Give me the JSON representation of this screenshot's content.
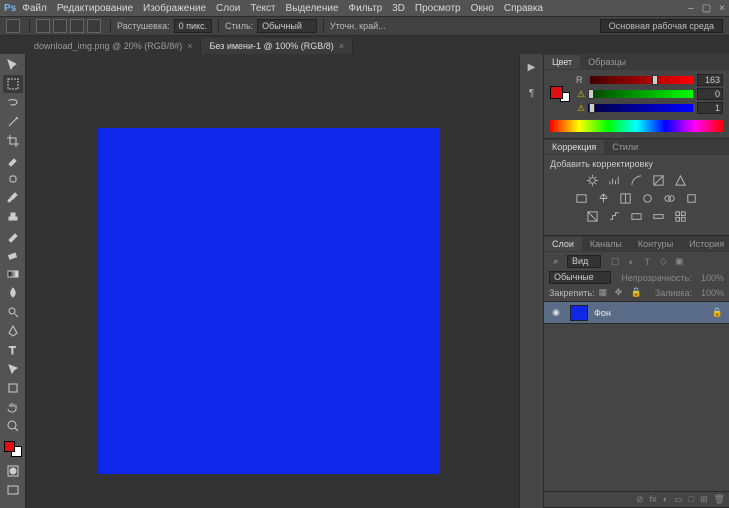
{
  "app": {
    "logo": "Ps"
  },
  "menu": {
    "items": [
      "Файл",
      "Редактирование",
      "Изображение",
      "Слои",
      "Текст",
      "Выделение",
      "Фильтр",
      "3D",
      "Просмотр",
      "Окно",
      "Справка"
    ]
  },
  "window_controls": {
    "minimize": "–",
    "restore": "▢",
    "close": "×"
  },
  "options": {
    "feather_label": "Растушевка:",
    "feather_value": "0 пикс.",
    "style_label": "Стиль:",
    "style_value": "Обычный",
    "refine_label": "Уточн. край...",
    "workspace": "Основная рабочая среда"
  },
  "tabs": [
    {
      "label": "download_img.png @ 20% (RGB/8#)",
      "close": "×"
    },
    {
      "label": "Без имени-1 @ 100% (RGB/8)",
      "close": "×"
    }
  ],
  "canvas": {
    "fill": "#1026e8"
  },
  "tool_names": [
    "move",
    "rect-marquee",
    "lasso",
    "wand",
    "crop",
    "eyedropper",
    "heal",
    "brush",
    "stamp",
    "history-brush",
    "eraser",
    "gradient",
    "blur",
    "dodge",
    "pen",
    "type",
    "path-select",
    "rectangle",
    "hand",
    "zoom"
  ],
  "panel_color": {
    "tab_active": "Цвет",
    "tab_other": "Образцы",
    "channels": {
      "r": "R",
      "g": "G",
      "b": "B"
    },
    "values": {
      "r": "163",
      "g": "0",
      "b": "1"
    }
  },
  "panel_adjust": {
    "tab_active": "Коррекция",
    "tab_other": "Стили",
    "title": "Добавить корректировку"
  },
  "panel_layers": {
    "tabs": [
      "Слои",
      "Каналы",
      "Контуры",
      "История"
    ],
    "search_icon": "⌕",
    "kind": "Вид",
    "blend": "Обычные",
    "opacity_label": "Непрозрачность:",
    "opacity_value": "100%",
    "lock_label": "Закрепить:",
    "fill_label": "Заливка:",
    "fill_value": "100%",
    "layers": [
      {
        "eye": "◉",
        "name": "Фон",
        "lock": "🔒"
      }
    ],
    "footer_icons": [
      "⊘",
      "fx",
      "◐",
      "▭",
      "□",
      "⊞",
      "🗑"
    ]
  }
}
